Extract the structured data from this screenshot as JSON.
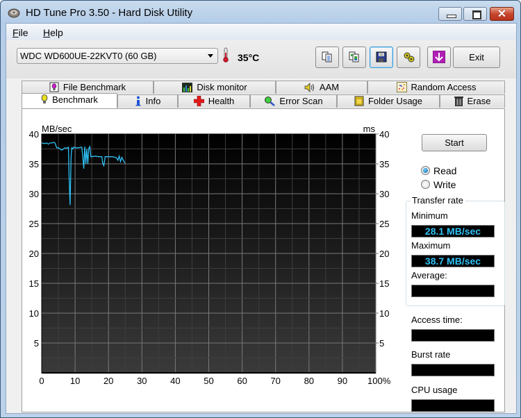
{
  "window": {
    "title": "HD Tune Pro 3.50 - Hard Disk Utility",
    "controls": {
      "minimize": "minimize",
      "maximize": "maximize",
      "close": "✕"
    }
  },
  "menu": {
    "items": [
      {
        "label": "File",
        "accel": "F",
        "rest": "ile"
      },
      {
        "label": "Help",
        "accel": "H",
        "rest": "elp"
      }
    ]
  },
  "toolbar": {
    "drive": "WDC WD600UE-22KVT0 (60 GB)",
    "temperature": "35°C",
    "buttons": [
      {
        "name": "copy-text",
        "icon": "copy-text-icon"
      },
      {
        "name": "copy-screenshot",
        "icon": "copy-image-icon"
      },
      {
        "name": "save",
        "icon": "floppy-disk-icon"
      },
      {
        "name": "options",
        "icon": "gears-icon"
      },
      {
        "name": "download",
        "icon": "download-arrow-icon"
      }
    ],
    "exit_label": "Exit"
  },
  "tabs": {
    "top_row": [
      {
        "label": "File Benchmark",
        "icon": "file-benchmark-icon"
      },
      {
        "label": "Disk monitor",
        "icon": "disk-monitor-icon"
      },
      {
        "label": "AAM",
        "icon": "speaker-icon"
      },
      {
        "label": "Random Access",
        "icon": "random-access-icon"
      }
    ],
    "bottom_row": [
      {
        "label": "Benchmark",
        "icon": "lightbulb-icon",
        "selected": true
      },
      {
        "label": "Info",
        "icon": "info-icon"
      },
      {
        "label": "Health",
        "icon": "red-cross-icon"
      },
      {
        "label": "Error Scan",
        "icon": "magnifier-icon"
      },
      {
        "label": "Folder Usage",
        "icon": "folder-icon"
      },
      {
        "label": "Erase",
        "icon": "trash-icon"
      }
    ]
  },
  "benchmark": {
    "start_label": "Start",
    "mode_options": [
      {
        "label": "Read",
        "selected": true
      },
      {
        "label": "Write",
        "selected": false
      }
    ],
    "transfer_rate": {
      "legend": "Transfer rate",
      "minimum_label": "Minimum",
      "minimum_value": "28.1 MB/sec",
      "maximum_label": "Maximum",
      "maximum_value": "38.7 MB/sec",
      "average_label": "Average:",
      "average_value": ""
    },
    "access_time_label": "Access time:",
    "access_time_value": "",
    "burst_rate_label": "Burst rate",
    "burst_rate_value": "",
    "cpu_usage_label": "CPU usage",
    "cpu_usage_value": ""
  },
  "colors": {
    "line": "#2ec1f5",
    "readout_text": "#2ec1f5",
    "plot_top": "#000000",
    "plot_bottom": "#3a3a3a"
  },
  "chart_data": {
    "type": "line",
    "title": "",
    "ylabel_left": "MB/sec",
    "ylabel_right": "ms",
    "xlabel": "",
    "xlim": [
      0,
      100
    ],
    "ylim": [
      0,
      40
    ],
    "y2lim": [
      0,
      40
    ],
    "x_ticks": [
      "0",
      "10",
      "20",
      "30",
      "40",
      "50",
      "60",
      "70",
      "80",
      "90",
      "100%"
    ],
    "y_ticks": [
      "5",
      "10",
      "15",
      "20",
      "25",
      "30",
      "35",
      "40"
    ],
    "y2_ticks": [
      "5",
      "10",
      "15",
      "20",
      "25",
      "30",
      "35",
      "40"
    ],
    "grid": true,
    "series": [
      {
        "name": "Read transfer rate",
        "x": [
          0,
          1,
          1.5,
          2,
          2.5,
          3,
          3.5,
          4,
          4.5,
          5,
          6,
          7,
          7.5,
          8,
          8.2,
          8.5,
          8.8,
          9,
          9.3,
          9.6,
          10,
          11,
          12,
          12.3,
          12.6,
          12.9,
          13.2,
          13.5,
          13.8,
          14.1,
          14.4,
          14.7,
          15,
          16,
          17,
          18,
          18.3,
          18.6,
          19,
          20,
          21,
          22,
          22.4,
          22.8,
          23.2,
          23.6,
          24,
          24.5,
          25
        ],
        "y": [
          38.5,
          38.4,
          38.5,
          38.3,
          38.5,
          38.5,
          38.6,
          38.5,
          37.7,
          37.7,
          37.3,
          37.7,
          37.6,
          37.8,
          33.0,
          28.1,
          36.0,
          37.7,
          37.5,
          37.8,
          37.7,
          37.7,
          37.8,
          36.2,
          34.2,
          37.9,
          35.0,
          37.5,
          35.0,
          37.6,
          37.9,
          36.2,
          36.2,
          36.3,
          36.2,
          36.2,
          35.0,
          34.7,
          36.2,
          36.2,
          36.2,
          36.1,
          36.0,
          35.6,
          36.3,
          35.4,
          36.1,
          35.5,
          35.1
        ]
      }
    ]
  }
}
